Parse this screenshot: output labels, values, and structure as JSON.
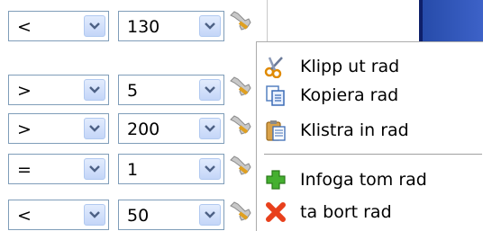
{
  "rows": [
    {
      "operator": "<",
      "value": "130"
    },
    {
      "operator": ">",
      "value": "5"
    },
    {
      "operator": ">",
      "value": "200"
    },
    {
      "operator": "=",
      "value": "1"
    },
    {
      "operator": "<",
      "value": "50"
    }
  ],
  "context_menu": {
    "items": [
      {
        "label": "Klipp ut rad",
        "icon": "scissors-icon"
      },
      {
        "label": "Kopiera rad",
        "icon": "copy-icon"
      },
      {
        "label": "Klistra in rad",
        "icon": "paste-icon"
      },
      {
        "label": "Infoga tom rad",
        "icon": "insert-icon"
      },
      {
        "label": "ta bort rad",
        "icon": "delete-icon"
      }
    ]
  },
  "colors": {
    "combo_border": "#7f9db9",
    "accent_blue": "#2f53b6"
  }
}
